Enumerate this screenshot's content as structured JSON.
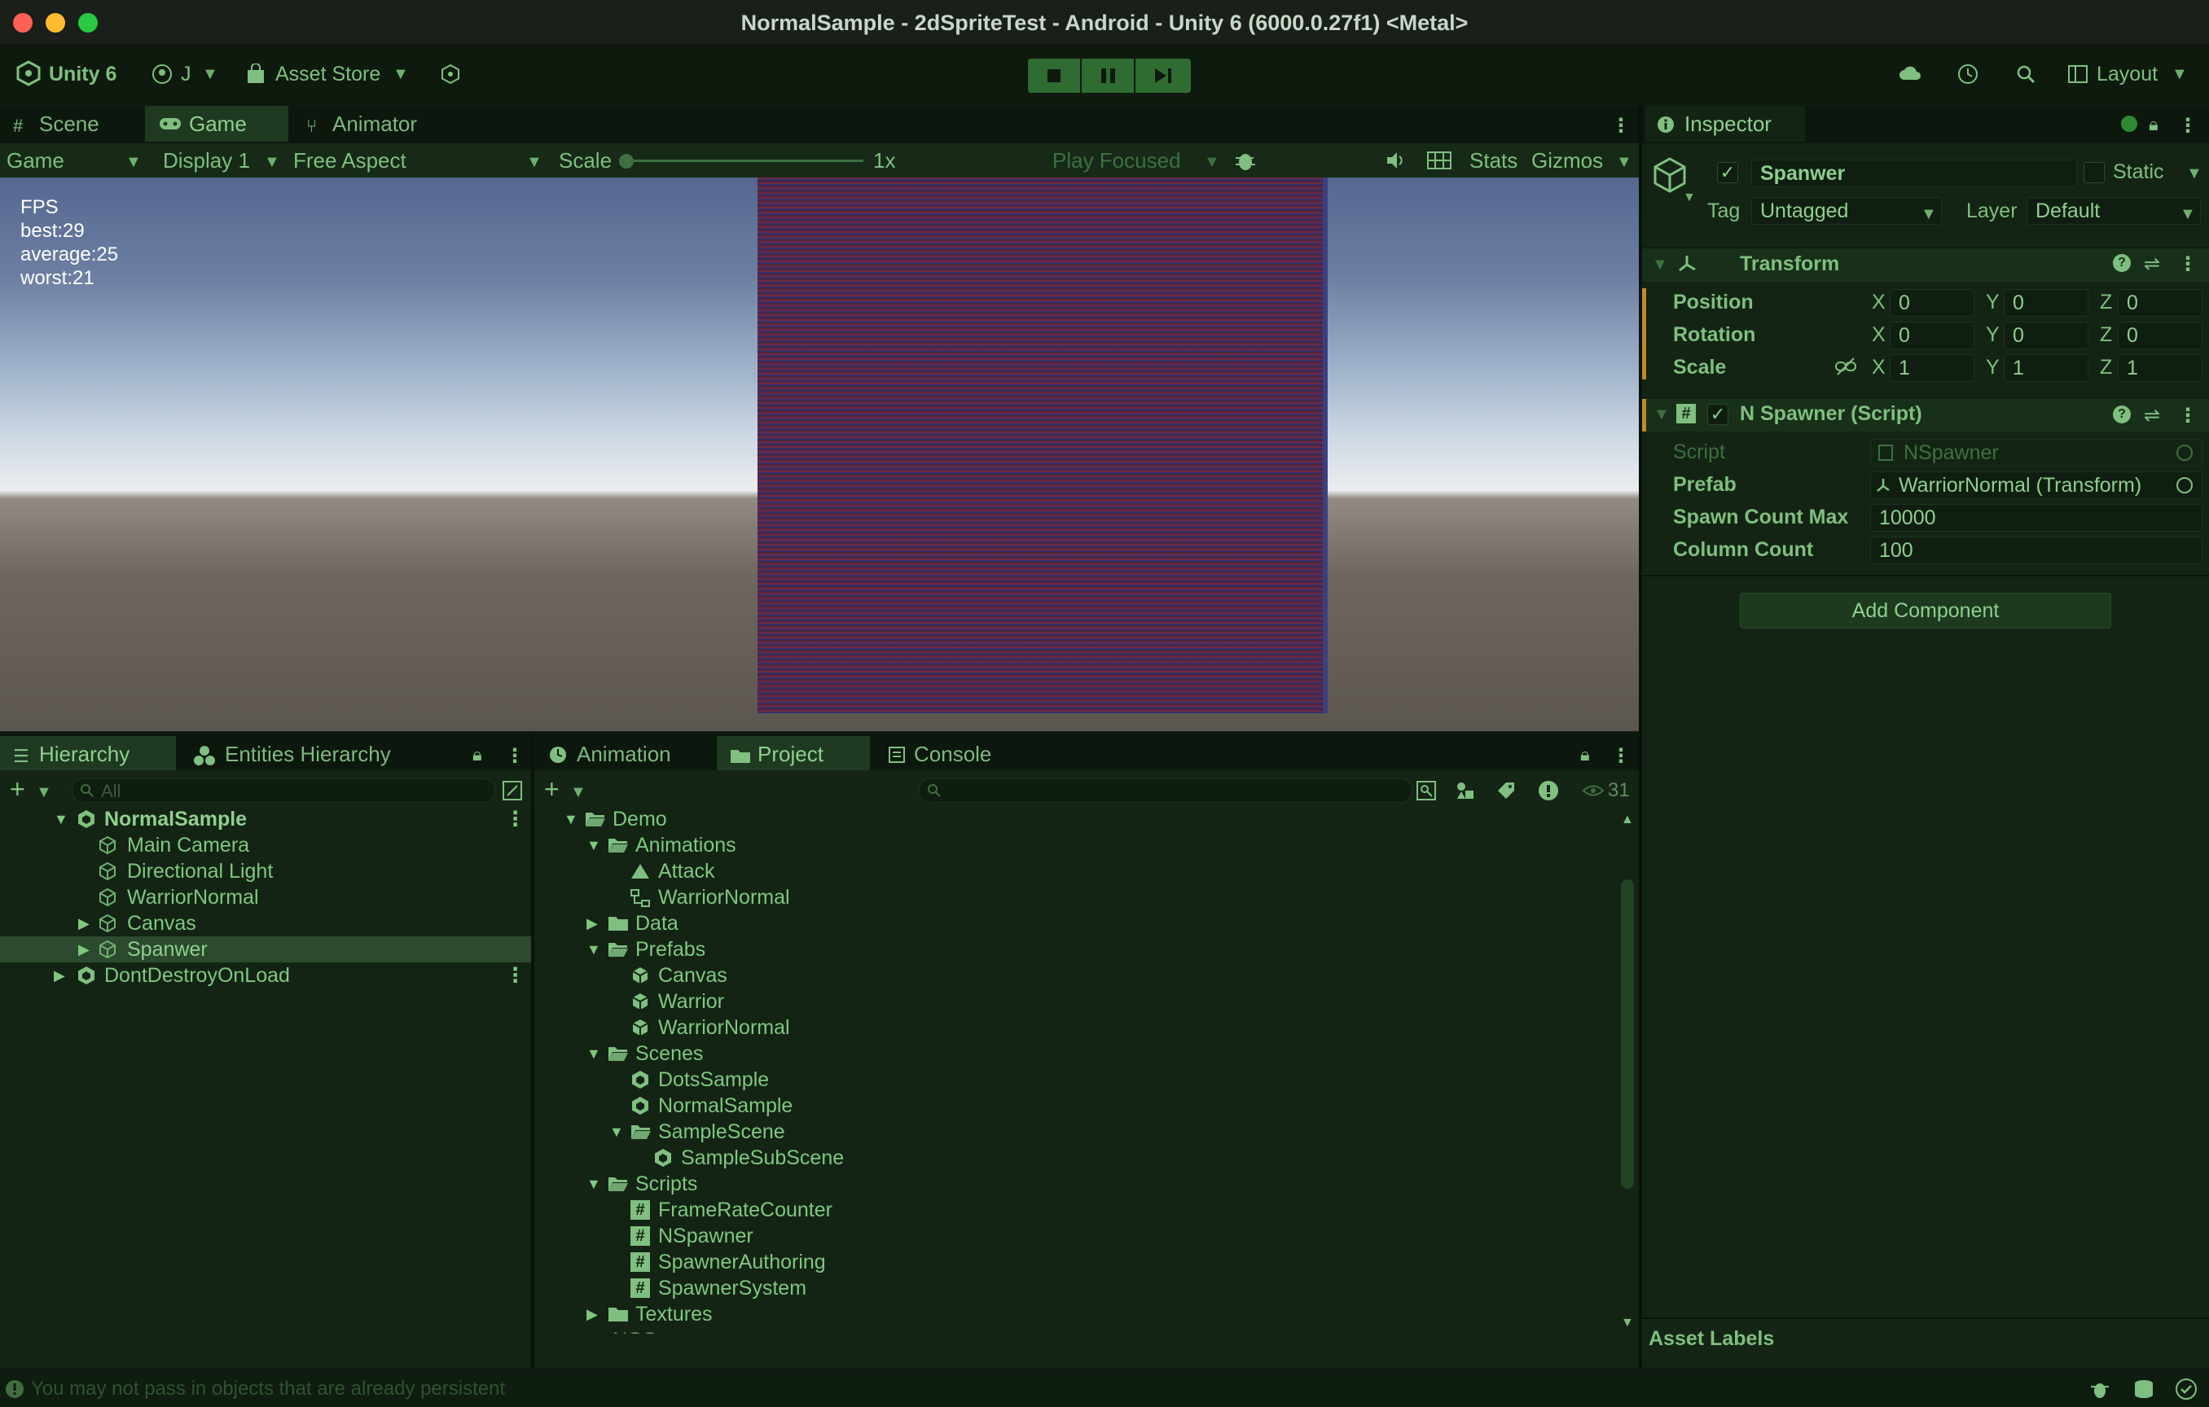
{
  "window": {
    "title": "NormalSample - 2dSpriteTest - Android - Unity 6 (6000.0.27f1) <Metal>"
  },
  "toolbar": {
    "unity_label": "Unity 6",
    "account_label": "J",
    "asset_store_label": "Asset Store",
    "layout_label": "Layout"
  },
  "scene_tabs": {
    "scene": "Scene",
    "game": "Game",
    "animator": "Animator"
  },
  "game_toolbar": {
    "game_dropdown": "Game",
    "display": "Display 1",
    "aspect": "Free Aspect",
    "scale_label": "Scale",
    "scale_value": "1x",
    "play_focused": "Play Focused",
    "stats": "Stats",
    "gizmos": "Gizmos"
  },
  "game_view": {
    "fps_lines": [
      "FPS",
      "best:29",
      "average:25",
      "worst:21"
    ]
  },
  "hierarchy": {
    "tab": "Hierarchy",
    "entities_tab": "Entities Hierarchy",
    "search_placeholder": "All",
    "items": [
      "NormalSample",
      "Main Camera",
      "Directional Light",
      "WarriorNormal",
      "Canvas",
      "Spanwer",
      "DontDestroyOnLoad"
    ]
  },
  "project": {
    "tabs": [
      "Animation",
      "Project",
      "Console"
    ],
    "hidden_count": "31",
    "items": [
      "Demo",
      "Animations",
      "Attack",
      "WarriorNormal",
      "Data",
      "Prefabs",
      "Canvas",
      "Warrior",
      "WarriorNormal",
      "Scenes",
      "DotsSample",
      "NormalSample",
      "SampleScene",
      "SampleSubScene",
      "Scripts",
      "FrameRateCounter",
      "NSpawner",
      "SpawnerAuthoring",
      "SpawnerSystem",
      "Textures",
      "NGS..."
    ]
  },
  "inspector": {
    "tab": "Inspector",
    "object_name": "Spanwer",
    "static_label": "Static",
    "tag_label": "Tag",
    "tag_value": "Untagged",
    "layer_label": "Layer",
    "layer_value": "Default",
    "transform": {
      "title": "Transform",
      "position": {
        "label": "Position",
        "x": "0",
        "y": "0",
        "z": "0"
      },
      "rotation": {
        "label": "Rotation",
        "x": "0",
        "y": "0",
        "z": "0"
      },
      "scale": {
        "label": "Scale",
        "x": "1",
        "y": "1",
        "z": "1"
      },
      "axis_x": "X",
      "axis_y": "Y",
      "axis_z": "Z"
    },
    "script_component": {
      "title": "N Spawner (Script)",
      "script_label": "Script",
      "script_value": "NSpawner",
      "prefab_label": "Prefab",
      "prefab_value": "WarriorNormal (Transform)",
      "spawn_label": "Spawn Count Max",
      "spawn_value": "10000",
      "column_label": "Column Count",
      "column_value": "100"
    },
    "add_component": "Add Component",
    "asset_labels": "Asset Labels"
  },
  "status_bar": {
    "message": "You may not pass in objects that are already persistent"
  },
  "colors": {
    "bg": "#132414",
    "accent": "#8fd08f",
    "selection": "#2c4a2e",
    "sky_top": "#5a6e96",
    "ground": "#5c5650"
  }
}
